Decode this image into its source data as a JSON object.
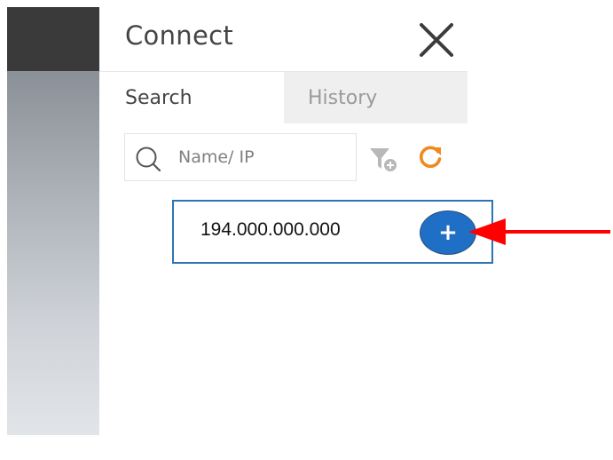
{
  "panel": {
    "title": "Connect"
  },
  "tabs": [
    {
      "label": "Search",
      "active": true
    },
    {
      "label": "History",
      "active": false
    }
  ],
  "search": {
    "placeholder": "Name/ IP",
    "value": ""
  },
  "icons": {
    "close": "close-icon",
    "search": "search-icon",
    "filter": "filter-add-icon",
    "refresh": "refresh-icon",
    "add": "plus-icon"
  },
  "device": {
    "ip": "194.000.000.000",
    "add_label": "+"
  },
  "colors": {
    "accent_blue": "#1f6fc6",
    "row_border": "#2e74b5",
    "refresh_orange": "#f08a1e",
    "annotation_red": "#ff0000",
    "sidebar_dark": "#3a3a3a"
  }
}
